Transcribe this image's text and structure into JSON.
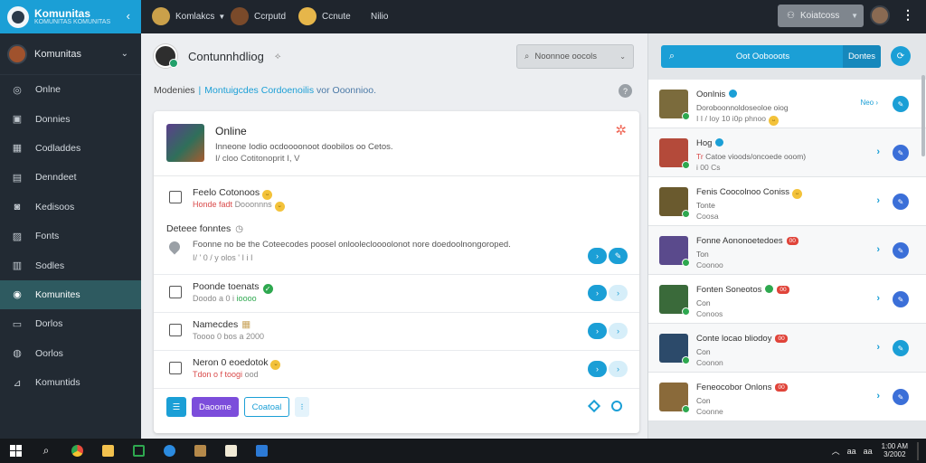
{
  "app": {
    "name": "Komunitas",
    "tagline": "KOMUNITAS KOMUNITAS"
  },
  "topbar": {
    "users": [
      {
        "name": "Komlakcs",
        "has_caret": true
      },
      {
        "name": "Ccrputd"
      },
      {
        "name": "Ccnute"
      },
      {
        "name": "Nilio"
      }
    ],
    "search_button": "Koiatcoss",
    "collapse_icon": "chevron-left-icon"
  },
  "sidebar": {
    "user": "Komunitas",
    "items": [
      {
        "label": "Onlne",
        "icon": "globe-icon"
      },
      {
        "label": "Donnies",
        "icon": "briefcase-icon"
      },
      {
        "label": "Codladdes",
        "icon": "grid-icon"
      },
      {
        "label": "Denndeet",
        "icon": "list-icon"
      },
      {
        "label": "Kedisoos",
        "icon": "camera-icon"
      },
      {
        "label": "Fonts",
        "icon": "image-icon"
      },
      {
        "label": "Sodles",
        "icon": "document-icon"
      },
      {
        "label": "Komunites",
        "icon": "chat-icon",
        "active": true
      },
      {
        "label": "Dorlos",
        "icon": "folder-icon"
      },
      {
        "label": "Oorlos",
        "icon": "settings-icon"
      },
      {
        "label": "Komuntids",
        "icon": "chart-icon"
      }
    ]
  },
  "main": {
    "title": "Contunnhdliog",
    "select_label": "Noonnoe oocols",
    "breadcrumb": {
      "root": "Modenies",
      "link1": "Montuigcdes",
      "link2": "Cordoenoilis",
      "rest": "vor Ooonnioo."
    },
    "card": {
      "name": "Online",
      "description": "Inneone Iodio ocdoooonoot doobilos oo Cetos.",
      "meta": "I/ cloo Cotitonoprit I, V",
      "rows": [
        {
          "title": "Feelo Cotonoos",
          "sub_red": "Honde fadt",
          "sub_gray": "Dooonnns",
          "icon": "smile-emoji-icon",
          "actions": false
        },
        {
          "title": "Poonde toenats",
          "sub_red": "Doodo a 0 i",
          "sub_gray": "ioooo",
          "icon": "check-icon",
          "actions": true
        },
        {
          "title": "Namecdes",
          "sub_gray": "Toooo 0 bos a 2000",
          "icon": "grid-icon",
          "actions": true
        },
        {
          "title": "Neron 0 eoedotok",
          "sub_red": "Tdon o f toogi",
          "sub_gray": "ood",
          "icon": "smile-emoji-icon",
          "actions": true
        }
      ],
      "section": {
        "label": "Deteee fonntes",
        "text": "Foonne no be the Coteecodes poosel onloolecloooolonot nore doedoolnongoroped.",
        "meta": "I/ ' 0 / y olos ' I i I"
      },
      "footer": {
        "primary": "Daoome",
        "secondary": "Coatoal"
      }
    }
  },
  "right": {
    "search_placeholder": "Oot Oobooots",
    "search_button": "Dontes",
    "items": [
      {
        "name": "Oonlnis",
        "badge": "blue",
        "sub": "Doroboonnoldoseoloe oiog",
        "meta": "I I / Ioy 10 i0p phnoo",
        "meta_emoji": true,
        "link": "Neo ›",
        "action": "blue",
        "color": "#7b6b3c"
      },
      {
        "name": "Hog",
        "badge": "blue",
        "sub_red": "Tr",
        "sub": "Catoe vioods/oncoede ooom)",
        "meta": "i",
        "meta_extra": "00 Cs",
        "action": "indigo",
        "color": "#b44a3a"
      },
      {
        "name": "Fenis Coocolnoo Coniss",
        "badge": "emoji",
        "sub": "Tonte",
        "meta": "Coosa",
        "action": "indigo",
        "color": "#6a5a2e"
      },
      {
        "name": "Fonne Aononoetedoes",
        "badge": "red",
        "badge_text": "00",
        "sub": "Ton",
        "meta": "Coonoo",
        "action": "indigo",
        "color": "#5a4a8c"
      },
      {
        "name": "Fonten Soneotos",
        "badge": "green-red",
        "badge_text": "00",
        "sub": "Con",
        "meta": "Conoos",
        "action": "indigo",
        "color": "#3a6a3a"
      },
      {
        "name": "Conte locao bliodoy",
        "badge": "red",
        "badge_text": "00",
        "sub": "Con",
        "meta": "Coonon",
        "action": "blue",
        "color": "#2c4a6a"
      },
      {
        "name": "Feneocobor Onlons",
        "badge": "red",
        "badge_text": "00",
        "sub": "Con",
        "meta": "Coonne",
        "action": "indigo",
        "color": "#8a6a3a"
      }
    ]
  },
  "taskbar": {
    "tray_a": "aa",
    "tray_b": "aa",
    "time": "1:00 AM",
    "date": "3/2002"
  }
}
